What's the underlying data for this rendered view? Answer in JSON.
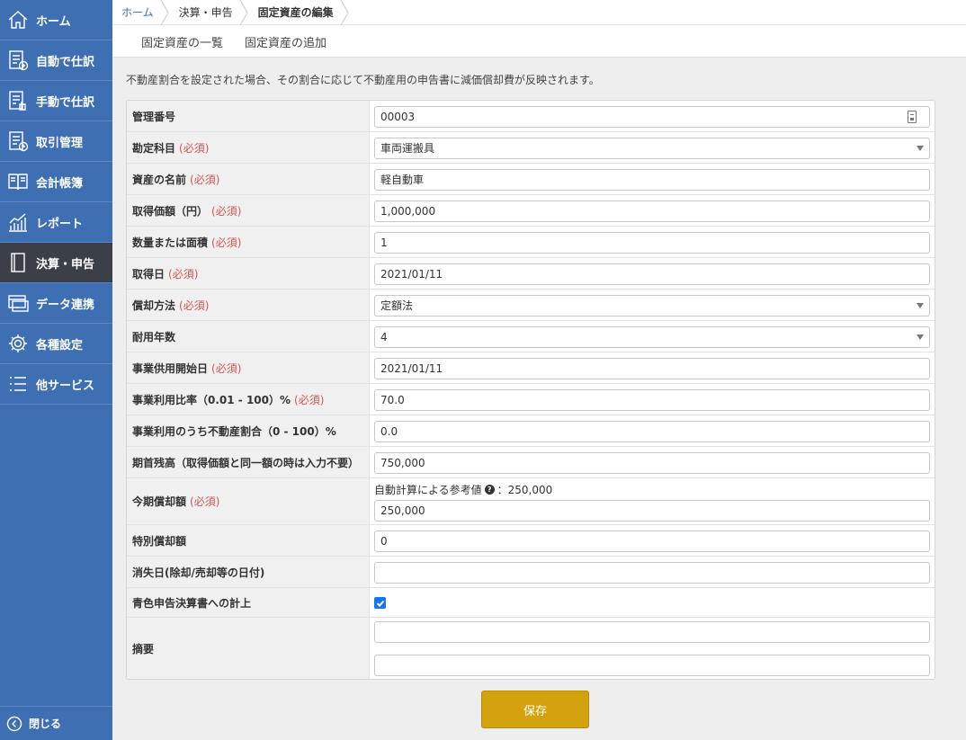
{
  "sidebar": {
    "items": [
      {
        "label": "ホーム",
        "icon": "home-icon"
      },
      {
        "label": "自動で仕訳",
        "icon": "auto-journal-icon"
      },
      {
        "label": "手動で仕訳",
        "icon": "manual-journal-icon"
      },
      {
        "label": "取引管理",
        "icon": "transactions-icon"
      },
      {
        "label": "会計帳簿",
        "icon": "ledger-book-icon"
      },
      {
        "label": "レポート",
        "icon": "report-chart-icon"
      },
      {
        "label": "決算・申告",
        "icon": "tax-return-icon",
        "active": true
      },
      {
        "label": "データ連携",
        "icon": "data-link-icon"
      },
      {
        "label": "各種設定",
        "icon": "gear-icon"
      },
      {
        "label": "他サービス",
        "icon": "list-icon"
      }
    ],
    "close_label": "閉じる"
  },
  "breadcrumb": [
    "ホーム",
    "決算・申告",
    "固定資産の編集"
  ],
  "subtabs": [
    "固定資産の一覧",
    "固定資産の追加"
  ],
  "notice": "不動産割合を設定された場合、その割合に応じて不動産用の申告書に減価償却費が反映されます。",
  "required_mark": "(必須)",
  "form": {
    "management_no": {
      "label": "管理番号",
      "value": "00003"
    },
    "account": {
      "label": "勘定科目",
      "value": "車両運搬具"
    },
    "asset_name": {
      "label": "資産の名前",
      "value": "軽自動車"
    },
    "acquisition_cost": {
      "label": "取得価額（円）",
      "value": "1,000,000"
    },
    "quantity": {
      "label": "数量または面積",
      "value": "1"
    },
    "acquisition_date": {
      "label": "取得日",
      "value": "2021/01/11"
    },
    "depreciation_method": {
      "label": "償却方法",
      "value": "定額法"
    },
    "useful_life": {
      "label": "耐用年数",
      "value": "4"
    },
    "service_start_date": {
      "label": "事業供用開始日",
      "value": "2021/01/11"
    },
    "business_ratio": {
      "label": "事業利用比率（0.01 - 100）%",
      "value": "70.0"
    },
    "real_estate_ratio": {
      "label": "事業利用のうち不動産割合（0 - 100）%",
      "value": "0.0"
    },
    "opening_balance": {
      "label": "期首残高（取得価額と同一額の時は入力不要）",
      "value": "750,000"
    },
    "current_depreciation": {
      "label": "今期償却額",
      "hint": "自動計算による参考値",
      "hint_value": "：250,000",
      "value": "250,000"
    },
    "special_depreciation": {
      "label": "特別償却額",
      "value": "0"
    },
    "disposal_date": {
      "label": "消失日(除却/売却等の日付)",
      "value": ""
    },
    "blue_return": {
      "label": "青色申告決算書への計上",
      "checked": true
    },
    "summary": {
      "label": "摘要",
      "value1": "",
      "value2": ""
    }
  },
  "save_label": "保存"
}
